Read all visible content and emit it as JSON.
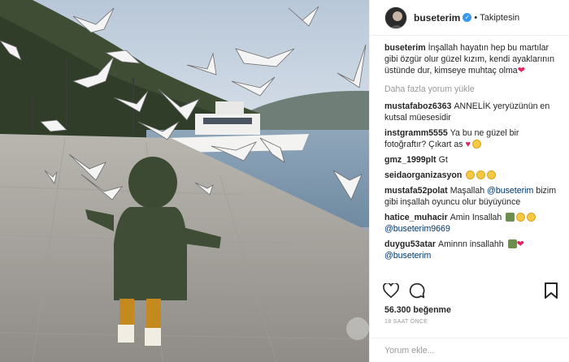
{
  "post": {
    "username": "buseterim",
    "follow_status": "Takiptesin",
    "caption": "İnşallah hayatın hep bu martılar gibi özgür olur güzel kızım, kendi ayaklarının üstünde dur, kimseye muhtaç olma",
    "load_more": "Daha fazla yorum yükle",
    "comments": [
      {
        "user": "mustafaboz6363",
        "text": "ANNELİK yeryüzünün en kutsal müesesidir"
      },
      {
        "user": "instgramm5555",
        "text": "Ya bu ne güzel bir fotoğraftır? Çıkart as"
      },
      {
        "user": "gmz_1999plt",
        "text": "Gt"
      },
      {
        "user": "seidaorganizasyon",
        "text": ""
      },
      {
        "user": "mustafa52polat",
        "text": "Maşallah",
        "mention": "@buseterim",
        "text2": "bizim gibi inşallah oyuncu olur büyüyünce"
      },
      {
        "user": "hatice_muhacir",
        "text": "Amin Insallah",
        "mention": "@buseterim9669"
      },
      {
        "user": "duygu53atar",
        "text": "Aminnn insallahh",
        "mention": "@buseterim"
      }
    ],
    "likes": "56.300 beğenme",
    "time_ago": "18 SAAT ÖNCE",
    "comment_placeholder": "Yorum ekle..."
  },
  "icons": {
    "like": "heart-outline-icon",
    "comment": "speech-bubble-icon",
    "save": "bookmark-icon",
    "verified": "verified-badge-icon"
  },
  "colors": {
    "verified": "#3897f0",
    "heart": "#e0245e",
    "muted": "#999999",
    "text": "#262626"
  }
}
